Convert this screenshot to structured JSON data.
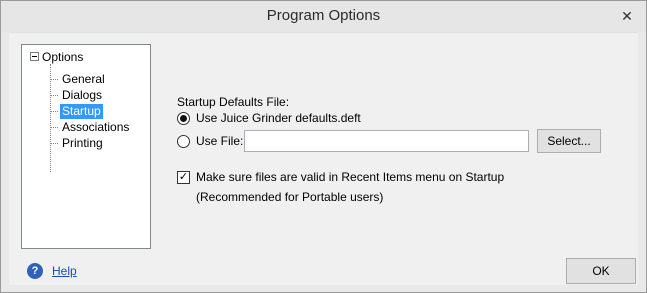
{
  "window": {
    "title": "Program Options",
    "close_symbol": "✕"
  },
  "tree": {
    "root_label": "Options",
    "items": [
      {
        "label": "General",
        "selected": false
      },
      {
        "label": "Dialogs",
        "selected": false
      },
      {
        "label": "Startup",
        "selected": true
      },
      {
        "label": "Associations",
        "selected": false
      },
      {
        "label": "Printing",
        "selected": false
      }
    ]
  },
  "startup": {
    "group_label": "Startup Defaults File:",
    "option_defaults_label": "Use Juice Grinder defaults.deft",
    "option_defaults_checked": true,
    "option_file_label": "Use File:",
    "option_file_checked": false,
    "file_value": "",
    "select_button_label": "Select...",
    "validate_checkbox_label": "Make sure files are valid in Recent Items menu on Startup",
    "validate_checked": true,
    "validate_hint": "(Recommended for Portable users)"
  },
  "footer": {
    "help_icon_glyph": "?",
    "help_label": "Help",
    "ok_label": "OK"
  },
  "colors": {
    "selection": "#3399ff",
    "help_icon": "#2e62b8",
    "link": "#1a4bb5"
  },
  "icons": {
    "tree_expander": "collapse-icon",
    "help": "help-icon"
  }
}
